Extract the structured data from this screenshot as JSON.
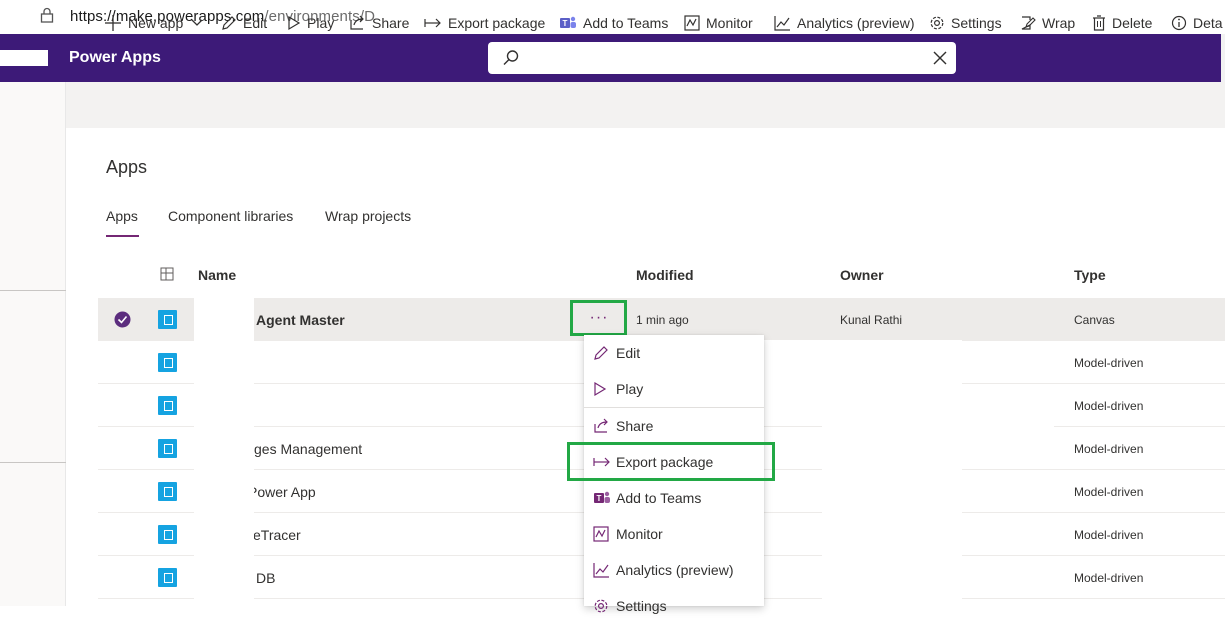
{
  "browser": {
    "url_host": "https://make.powerapps.com",
    "url_path": "/environments/D"
  },
  "header": {
    "brand": "Power Apps",
    "search_value": ""
  },
  "commands": [
    {
      "label": "New app",
      "icon": "plus-icon"
    },
    {
      "label": "Edit",
      "icon": "pencil-icon"
    },
    {
      "label": "Play",
      "icon": "play-icon"
    },
    {
      "label": "Share",
      "icon": "share-icon"
    },
    {
      "label": "Export package",
      "icon": "export-icon"
    },
    {
      "label": "Add to Teams",
      "icon": "teams-icon"
    },
    {
      "label": "Monitor",
      "icon": "monitor-icon"
    },
    {
      "label": "Analytics (preview)",
      "icon": "analytics-icon"
    },
    {
      "label": "Settings",
      "icon": "gear-icon"
    },
    {
      "label": "Wrap",
      "icon": "wrap-icon"
    },
    {
      "label": "Delete",
      "icon": "trash-icon"
    },
    {
      "label": "Deta",
      "icon": "info-icon"
    }
  ],
  "page": {
    "title": "Apps",
    "tabs": [
      "Apps",
      "Component libraries",
      "Wrap projects"
    ]
  },
  "table": {
    "columns": [
      "Name",
      "Modified",
      "Owner",
      "Type"
    ],
    "more_label": "···",
    "rows": [
      {
        "name": "Agent Master",
        "modified": "1 min ago",
        "owner": "Kunal Rathi",
        "type": "Canvas"
      },
      {
        "name": ".",
        "modified": "",
        "owner": "",
        "type": "Model-driven"
      },
      {
        "name": "",
        "modified": "",
        "owner": "",
        "type": "Model-driven"
      },
      {
        "name": "ges Management",
        "modified": "",
        "owner": "",
        "type": "Model-driven"
      },
      {
        "name": "Power App",
        "modified": "",
        "owner": "",
        "type": "Model-driven"
      },
      {
        "name": "eTracer",
        "modified": "",
        "owner": "",
        "type": "Model-driven"
      },
      {
        "name": "DB",
        "modified": "",
        "owner": "",
        "type": "Model-driven"
      }
    ]
  },
  "context_menu": [
    {
      "label": "Edit",
      "icon": "pencil-icon"
    },
    {
      "label": "Play",
      "icon": "play-icon"
    },
    {
      "label": "Share",
      "icon": "share-icon"
    },
    {
      "label": "Export package",
      "icon": "export-icon"
    },
    {
      "label": "Add to Teams",
      "icon": "teams-icon"
    },
    {
      "label": "Monitor",
      "icon": "monitor-icon"
    },
    {
      "label": "Analytics (preview)",
      "icon": "analytics-icon"
    },
    {
      "label": "Settings",
      "icon": "gear-icon"
    }
  ],
  "colors": {
    "header": "#3d1a78",
    "accent": "#742774",
    "app_icon": "#15a3e1",
    "highlight": "#22a845"
  }
}
